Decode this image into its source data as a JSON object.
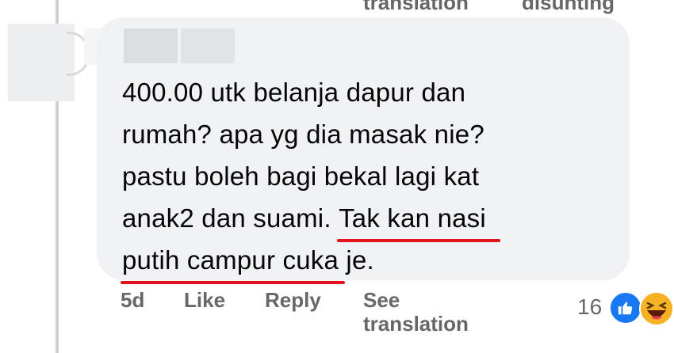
{
  "top_actions": {
    "translation_label": "translation",
    "disunting_label": "disunting"
  },
  "comment": {
    "lines": [
      "400.00 utk belanja dapur dan",
      "rumah? apa yg dia masak nie?",
      "pastu boleh bagi bekal lagi kat",
      "anak2 dan suami. "
    ],
    "underlined_part1": "Tak kan nasi",
    "underlined_part2": "putih campur cuka",
    "trailing": " je."
  },
  "actions": {
    "time": "5d",
    "like_label": "Like",
    "reply_label": "Reply",
    "see_translation_line1": "See",
    "see_translation_line2": "translation"
  },
  "reactions": {
    "count": "16",
    "icons": [
      "like-icon",
      "haha-icon"
    ]
  },
  "colors": {
    "bubble": "#f0f2f5",
    "muted_text": "#65676b",
    "underline": "#e0141e",
    "like_blue": "#1877f2",
    "haha_yellow": "#f7b125"
  }
}
